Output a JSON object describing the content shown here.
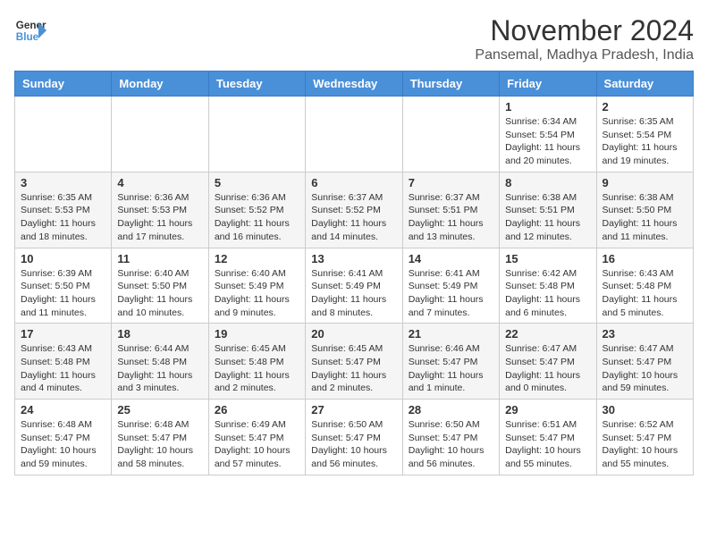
{
  "header": {
    "logo_line1": "General",
    "logo_line2": "Blue",
    "title": "November 2024",
    "subtitle": "Pansemal, Madhya Pradesh, India"
  },
  "weekdays": [
    "Sunday",
    "Monday",
    "Tuesday",
    "Wednesday",
    "Thursday",
    "Friday",
    "Saturday"
  ],
  "weeks": [
    [
      {
        "day": "",
        "info": ""
      },
      {
        "day": "",
        "info": ""
      },
      {
        "day": "",
        "info": ""
      },
      {
        "day": "",
        "info": ""
      },
      {
        "day": "",
        "info": ""
      },
      {
        "day": "1",
        "info": "Sunrise: 6:34 AM\nSunset: 5:54 PM\nDaylight: 11 hours and 20 minutes."
      },
      {
        "day": "2",
        "info": "Sunrise: 6:35 AM\nSunset: 5:54 PM\nDaylight: 11 hours and 19 minutes."
      }
    ],
    [
      {
        "day": "3",
        "info": "Sunrise: 6:35 AM\nSunset: 5:53 PM\nDaylight: 11 hours and 18 minutes."
      },
      {
        "day": "4",
        "info": "Sunrise: 6:36 AM\nSunset: 5:53 PM\nDaylight: 11 hours and 17 minutes."
      },
      {
        "day": "5",
        "info": "Sunrise: 6:36 AM\nSunset: 5:52 PM\nDaylight: 11 hours and 16 minutes."
      },
      {
        "day": "6",
        "info": "Sunrise: 6:37 AM\nSunset: 5:52 PM\nDaylight: 11 hours and 14 minutes."
      },
      {
        "day": "7",
        "info": "Sunrise: 6:37 AM\nSunset: 5:51 PM\nDaylight: 11 hours and 13 minutes."
      },
      {
        "day": "8",
        "info": "Sunrise: 6:38 AM\nSunset: 5:51 PM\nDaylight: 11 hours and 12 minutes."
      },
      {
        "day": "9",
        "info": "Sunrise: 6:38 AM\nSunset: 5:50 PM\nDaylight: 11 hours and 11 minutes."
      }
    ],
    [
      {
        "day": "10",
        "info": "Sunrise: 6:39 AM\nSunset: 5:50 PM\nDaylight: 11 hours and 11 minutes."
      },
      {
        "day": "11",
        "info": "Sunrise: 6:40 AM\nSunset: 5:50 PM\nDaylight: 11 hours and 10 minutes."
      },
      {
        "day": "12",
        "info": "Sunrise: 6:40 AM\nSunset: 5:49 PM\nDaylight: 11 hours and 9 minutes."
      },
      {
        "day": "13",
        "info": "Sunrise: 6:41 AM\nSunset: 5:49 PM\nDaylight: 11 hours and 8 minutes."
      },
      {
        "day": "14",
        "info": "Sunrise: 6:41 AM\nSunset: 5:49 PM\nDaylight: 11 hours and 7 minutes."
      },
      {
        "day": "15",
        "info": "Sunrise: 6:42 AM\nSunset: 5:48 PM\nDaylight: 11 hours and 6 minutes."
      },
      {
        "day": "16",
        "info": "Sunrise: 6:43 AM\nSunset: 5:48 PM\nDaylight: 11 hours and 5 minutes."
      }
    ],
    [
      {
        "day": "17",
        "info": "Sunrise: 6:43 AM\nSunset: 5:48 PM\nDaylight: 11 hours and 4 minutes."
      },
      {
        "day": "18",
        "info": "Sunrise: 6:44 AM\nSunset: 5:48 PM\nDaylight: 11 hours and 3 minutes."
      },
      {
        "day": "19",
        "info": "Sunrise: 6:45 AM\nSunset: 5:48 PM\nDaylight: 11 hours and 2 minutes."
      },
      {
        "day": "20",
        "info": "Sunrise: 6:45 AM\nSunset: 5:47 PM\nDaylight: 11 hours and 2 minutes."
      },
      {
        "day": "21",
        "info": "Sunrise: 6:46 AM\nSunset: 5:47 PM\nDaylight: 11 hours and 1 minute."
      },
      {
        "day": "22",
        "info": "Sunrise: 6:47 AM\nSunset: 5:47 PM\nDaylight: 11 hours and 0 minutes."
      },
      {
        "day": "23",
        "info": "Sunrise: 6:47 AM\nSunset: 5:47 PM\nDaylight: 10 hours and 59 minutes."
      }
    ],
    [
      {
        "day": "24",
        "info": "Sunrise: 6:48 AM\nSunset: 5:47 PM\nDaylight: 10 hours and 59 minutes."
      },
      {
        "day": "25",
        "info": "Sunrise: 6:48 AM\nSunset: 5:47 PM\nDaylight: 10 hours and 58 minutes."
      },
      {
        "day": "26",
        "info": "Sunrise: 6:49 AM\nSunset: 5:47 PM\nDaylight: 10 hours and 57 minutes."
      },
      {
        "day": "27",
        "info": "Sunrise: 6:50 AM\nSunset: 5:47 PM\nDaylight: 10 hours and 56 minutes."
      },
      {
        "day": "28",
        "info": "Sunrise: 6:50 AM\nSunset: 5:47 PM\nDaylight: 10 hours and 56 minutes."
      },
      {
        "day": "29",
        "info": "Sunrise: 6:51 AM\nSunset: 5:47 PM\nDaylight: 10 hours and 55 minutes."
      },
      {
        "day": "30",
        "info": "Sunrise: 6:52 AM\nSunset: 5:47 PM\nDaylight: 10 hours and 55 minutes."
      }
    ]
  ]
}
